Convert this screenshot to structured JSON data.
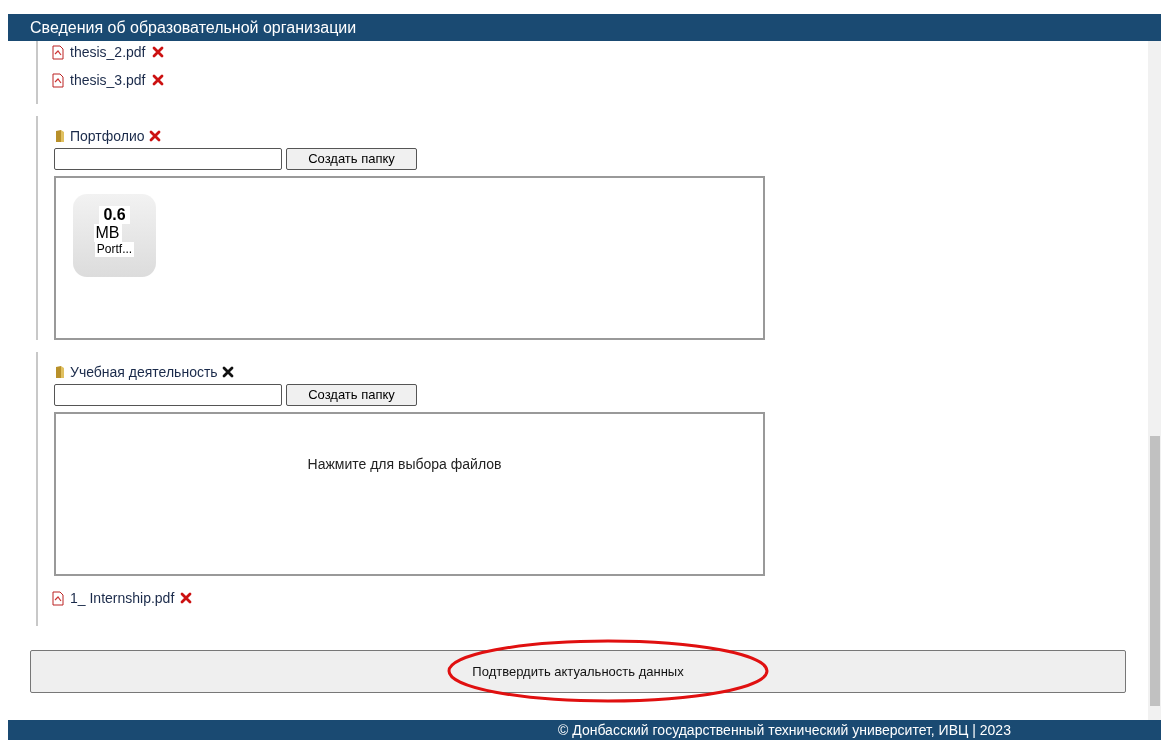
{
  "header": {
    "title": "Сведения об образовательной организации"
  },
  "sections": [
    {
      "files": [
        {
          "name": "thesis_2.pdf"
        },
        {
          "name": "thesis_3.pdf"
        }
      ]
    },
    {
      "folder": {
        "name": "Портфолио",
        "delete_active": false
      },
      "create_button": "Создать папку",
      "dropzone": {
        "tiles": [
          {
            "size": "0.6",
            "unit": "MB",
            "name": "Portf..."
          }
        ]
      }
    },
    {
      "folder": {
        "name": "Учебная деятельность",
        "delete_active": true
      },
      "create_button": "Создать папку",
      "dropzone": {
        "prompt": "Нажмите для выбора файлов"
      },
      "files": [
        {
          "name": "1_ Internship.pdf"
        }
      ]
    }
  ],
  "confirm_button": {
    "label": "Подтвердить актуальность данных",
    "circled": true
  },
  "footer": "© Донбасский государственный технический университет, ИВЦ | 2023"
}
